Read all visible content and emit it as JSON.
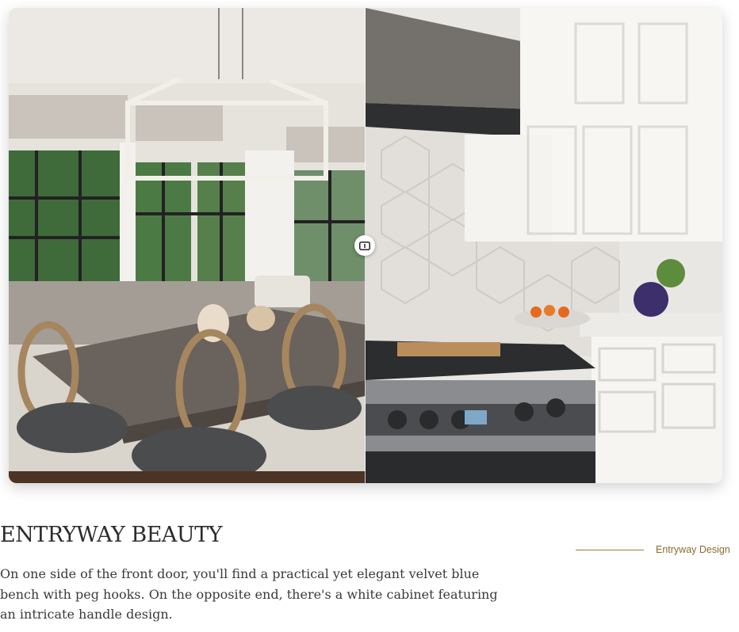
{
  "gallery": {
    "left_image": "dining nook with chandelier, windows, banquette and wooden chairs",
    "right_image": "kitchen with range hood, hexagon tile backsplash, white cabinets and stove",
    "toggle_icon": "compare-toggle-icon"
  },
  "project": {
    "title": "ENTRYWAY BEAUTY",
    "description": "On one side of the front door, you'll find a practical yet elegant velvet blue bench with peg hooks. On the opposite end, there's a white cabinet featuring an intricate handle design.",
    "tag": "Entryway Design"
  },
  "colors": {
    "accent": "#8b6a2f",
    "title": "#2c2c2c",
    "body_text": "#3a3a3a"
  }
}
